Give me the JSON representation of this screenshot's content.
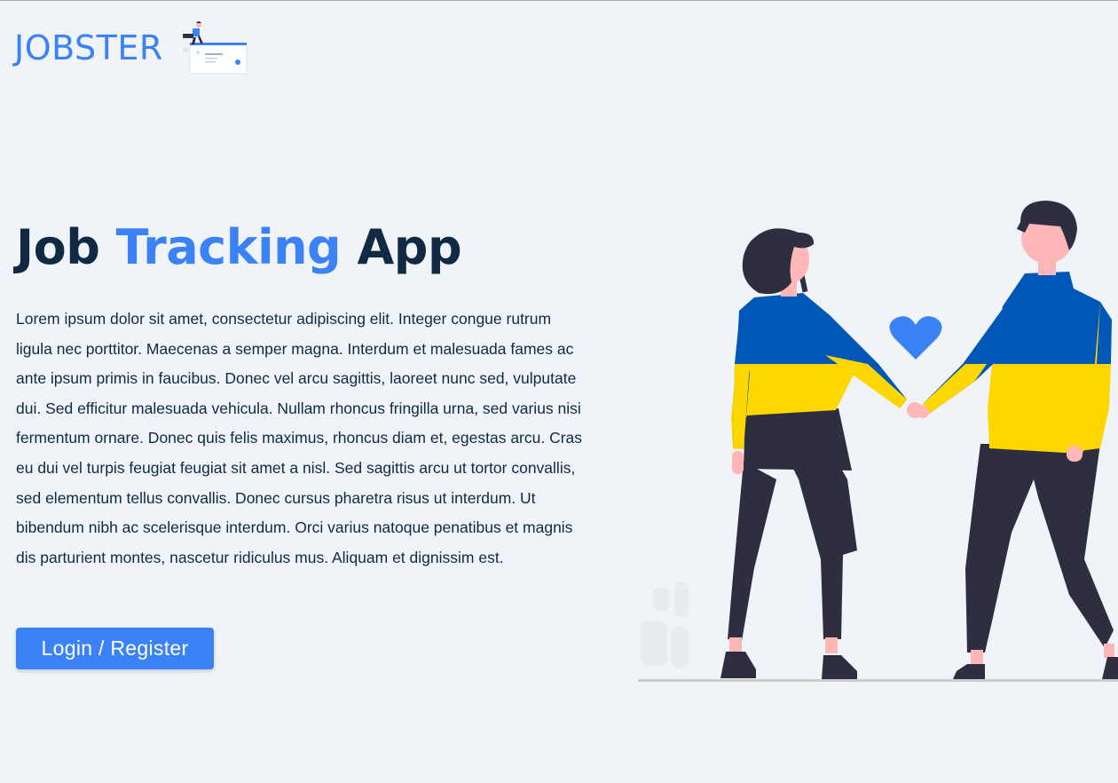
{
  "header": {
    "logo_text": "JOBSTER"
  },
  "hero": {
    "title_part1": "Job",
    "title_accent": "Tracking",
    "title_part2": "App",
    "body": "Lorem ipsum dolor sit amet, consectetur adipiscing elit. Integer congue rutrum ligula nec porttitor. Maecenas a semper magna. Interdum et malesuada fames ac ante ipsum primis in faucibus. Donec vel arcu sagittis, laoreet nunc sed, vulputate dui. Sed efficitur malesuada vehicula. Nullam rhoncus fringilla urna, sed varius nisi fermentum ornare. Donec quis felis maximus, rhoncus diam et, egestas arcu. Cras eu dui vel turpis feugiat feugiat sit amet a nisl. Sed sagittis arcu ut tortor convallis, sed elementum tellus convallis. Donec cursus pharetra risus ut interdum. Ut bibendum nibh ac scelerisque interdum. Orci varius natoque penatibus et magnis dis parturient montes, nascetur ridiculus mus. Aliquam et dignissim est.",
    "cta_label": "Login / Register"
  },
  "illustration": {
    "icon": "couple-holding-hands-illustration",
    "heart_icon": "heart-icon"
  },
  "colors": {
    "background": "#f0f4f8",
    "primary": "#3b82f6",
    "text": "#102a43",
    "sweater_blue": "#0057b8",
    "sweater_yellow": "#ffd700",
    "pants": "#2f2e41",
    "skin": "#ffb6b6"
  }
}
